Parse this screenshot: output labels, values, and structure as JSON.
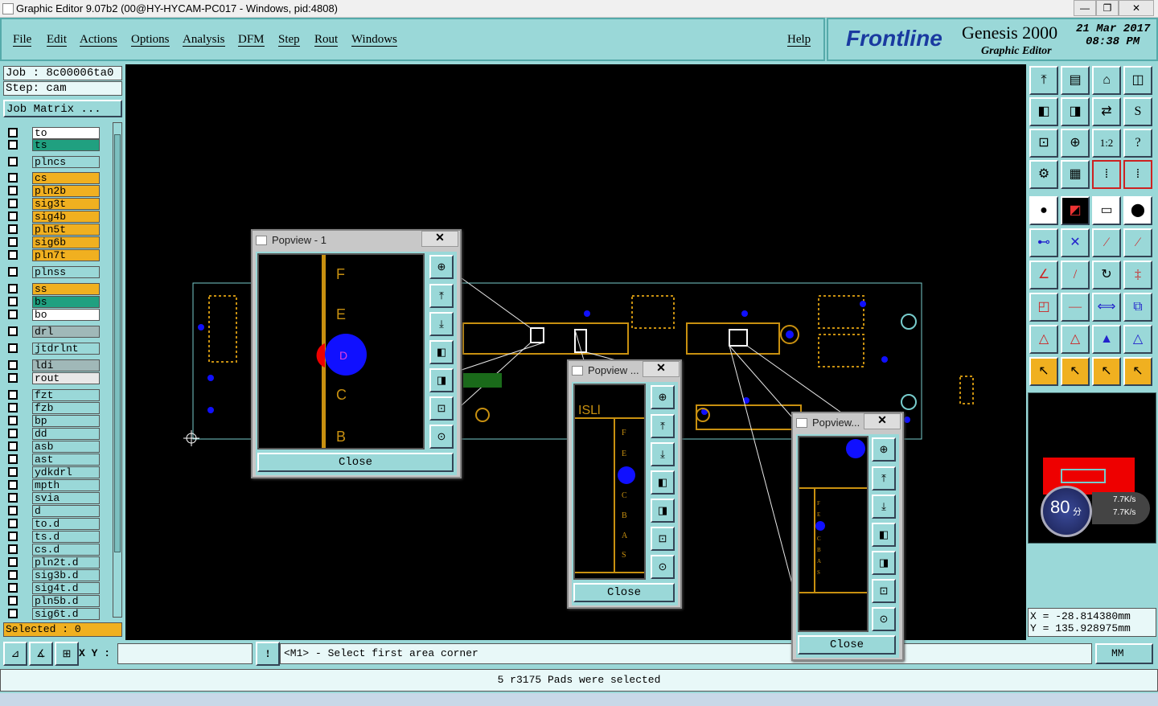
{
  "window": {
    "title": "Graphic Editor 9.07b2 (00@HY-HYCAM-PC017 - Windows, pid:4808)",
    "min": "—",
    "max": "❐",
    "close": "✕"
  },
  "menu": [
    {
      "label": "File"
    },
    {
      "label": "Edit"
    },
    {
      "label": "Actions"
    },
    {
      "label": "Options"
    },
    {
      "label": "Analysis"
    },
    {
      "label": "DFM"
    },
    {
      "label": "Step"
    },
    {
      "label": "Rout"
    },
    {
      "label": "Windows"
    }
  ],
  "help": "Help",
  "brand": {
    "logo": "Frontline",
    "product": "Genesis 2000",
    "subtitle": "Graphic Editor",
    "date": "21 Mar 2017",
    "time": "08:38 PM"
  },
  "job": {
    "job": "Job : 8c00006ta0",
    "step": "Step: cam",
    "matrix": "Job Matrix ..."
  },
  "layers": [
    {
      "name": "to",
      "color": "#ffffff"
    },
    {
      "name": "ts",
      "color": "#20a080"
    },
    {
      "name": "plncs",
      "color": "#9ad8d8"
    },
    {
      "name": "cs",
      "color": "#f0b020"
    },
    {
      "name": "pln2b",
      "color": "#f0b020"
    },
    {
      "name": "sig3t",
      "color": "#f0b020"
    },
    {
      "name": "sig4b",
      "color": "#f0b020"
    },
    {
      "name": "pln5t",
      "color": "#f0b020"
    },
    {
      "name": "sig6b",
      "color": "#f0b020"
    },
    {
      "name": "pln7t",
      "color": "#f0b020"
    },
    {
      "name": "plnss",
      "color": "#9ad8d8"
    },
    {
      "name": "ss",
      "color": "#f0b020"
    },
    {
      "name": "bs",
      "color": "#20a080"
    },
    {
      "name": "bo",
      "color": "#ffffff"
    },
    {
      "name": "drl",
      "color": "#a0b8b8"
    },
    {
      "name": "jtdrlnt",
      "color": "#9ad8d8"
    },
    {
      "name": "ldi",
      "color": "#a0b8b8"
    },
    {
      "name": "rout",
      "color": "#e8e8e8"
    },
    {
      "name": "fzt",
      "color": "#9ad8d8"
    },
    {
      "name": "fzb",
      "color": "#9ad8d8"
    },
    {
      "name": "bp",
      "color": "#9ad8d8"
    },
    {
      "name": "dd",
      "color": "#9ad8d8"
    },
    {
      "name": "asb",
      "color": "#9ad8d8"
    },
    {
      "name": "ast",
      "color": "#9ad8d8"
    },
    {
      "name": "ydkdrl",
      "color": "#9ad8d8"
    },
    {
      "name": "mpth",
      "color": "#9ad8d8"
    },
    {
      "name": "svia",
      "color": "#9ad8d8"
    },
    {
      "name": "d",
      "color": "#9ad8d8"
    },
    {
      "name": "to.d",
      "color": "#9ad8d8"
    },
    {
      "name": "ts.d",
      "color": "#9ad8d8"
    },
    {
      "name": "cs.d",
      "color": "#9ad8d8"
    },
    {
      "name": "pln2t.d",
      "color": "#9ad8d8"
    },
    {
      "name": "sig3b.d",
      "color": "#9ad8d8"
    },
    {
      "name": "sig4t.d",
      "color": "#9ad8d8"
    },
    {
      "name": "pln5b.d",
      "color": "#9ad8d8"
    },
    {
      "name": "sig6t.d",
      "color": "#9ad8d8"
    }
  ],
  "selected": "Selected : 0",
  "popviews": [
    {
      "title": "Popview - 1",
      "close": "Close"
    },
    {
      "title": "Popview ...",
      "close": "Close"
    },
    {
      "title": "Popview...",
      "close": "Close"
    }
  ],
  "net": {
    "score": "80",
    "unit": "分",
    "up": "7.7K/s",
    "down": "7.7K/s"
  },
  "coords": {
    "x": "X = -28.814380mm",
    "y": "Y = 135.928975mm"
  },
  "status": {
    "xy_label": "X Y :",
    "xy_value": "",
    "prompt": "<M1> - Select first area corner",
    "units": "MM"
  },
  "message": "5 r3175 Pads were selected",
  "colors": {
    "accent": "#9ad8d8",
    "canvas": "#000000",
    "trace": "#c89010",
    "pad": "#1010ff"
  }
}
